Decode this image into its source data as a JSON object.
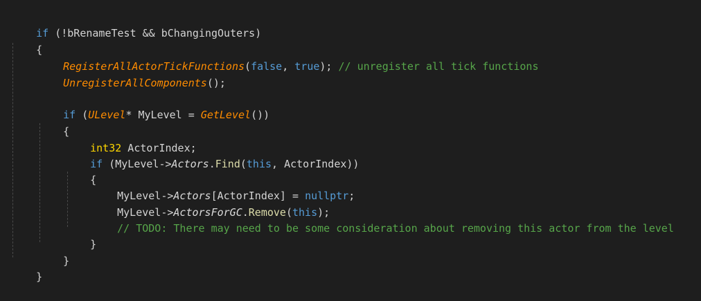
{
  "code": {
    "line1": {
      "kw": "if",
      "rest": " (!bRenameTest && bChangingOuters)"
    },
    "line2": {
      "brace": "{"
    },
    "line3": {
      "fn": "RegisterAllActorTickFunctions",
      "open": "(",
      "arg1": "false",
      "sep": ", ",
      "arg2": "true",
      "close": ");",
      "comment": " // unregister all tick functions"
    },
    "line4": {
      "fn": "UnregisterAllComponents",
      "rest": "();"
    },
    "line6": {
      "kw": "if",
      "p1": " (",
      "type": "ULevel",
      "p2": "* MyLevel = ",
      "fn": "GetLevel",
      "p3": "())"
    },
    "line7": {
      "brace": "{"
    },
    "line8": {
      "type": "int32",
      "rest": " ActorIndex;"
    },
    "line9": {
      "kw": "if",
      "p1": " (MyLevel->",
      "member": "Actors",
      "dot": ".",
      "method": "Find",
      "p2": "(",
      "this": "this",
      "p3": ", ActorIndex))"
    },
    "line10": {
      "brace": "{"
    },
    "line11": {
      "p1": "MyLevel->",
      "member": "Actors",
      "p2": "[ActorIndex] = ",
      "null": "nullptr",
      "p3": ";"
    },
    "line12": {
      "p1": "MyLevel->",
      "member": "ActorsForGC",
      "dot": ".",
      "method": "Remove",
      "p2": "(",
      "this": "this",
      "p3": ");"
    },
    "line13": {
      "comment": "// TODO: There may need to be some consideration about removing this actor from the level"
    },
    "line14": {
      "brace": "}"
    },
    "line15": {
      "brace": "}"
    },
    "line16": {
      "brace": "}"
    }
  }
}
